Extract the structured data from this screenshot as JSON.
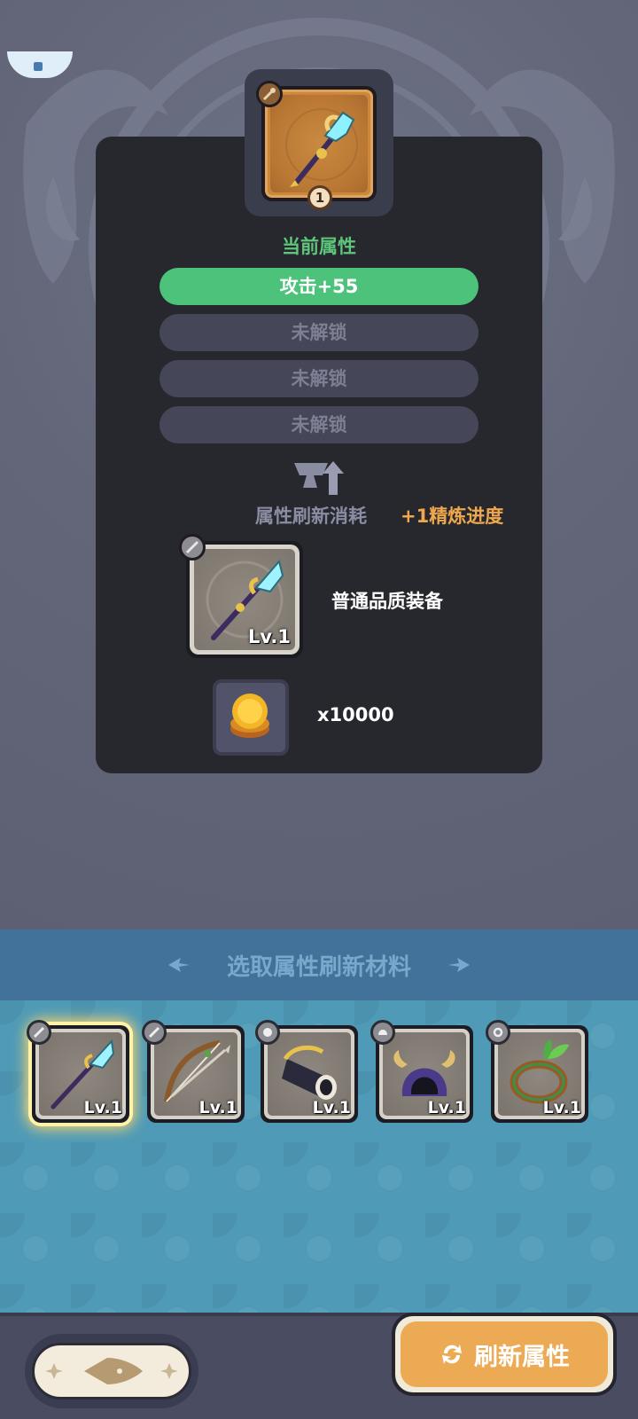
{
  "top_equipment": {
    "icon": "crystal-staff-icon",
    "type_icon": "staff-type-icon",
    "count": "1"
  },
  "attributes": {
    "title": "当前属性",
    "rows": [
      {
        "label": "攻击+55",
        "state": "active"
      },
      {
        "label": "未解锁",
        "state": "locked"
      },
      {
        "label": "未解锁",
        "state": "locked"
      },
      {
        "label": "未解锁",
        "state": "locked"
      }
    ]
  },
  "cost": {
    "label": "属性刷新消耗",
    "refine_progress": "+1精炼进度",
    "material": {
      "icon": "crystal-spear-icon",
      "level": "Lv.1",
      "label": "普通品质装备"
    },
    "coins": {
      "icon": "gold-coin-stack-icon",
      "amount": "x10000"
    }
  },
  "picker": {
    "title": "选取属性刷新材料",
    "items": [
      {
        "icon": "crystal-spear-icon",
        "badge_icon": "sword-type-icon",
        "level": "Lv.1",
        "selected": true
      },
      {
        "icon": "bow-icon",
        "badge_icon": "sword-type-icon",
        "level": "Lv.1",
        "selected": false
      },
      {
        "icon": "bracer-icon",
        "badge_icon": "glove-type-icon",
        "level": "Lv.1",
        "selected": false
      },
      {
        "icon": "horned-hood-icon",
        "badge_icon": "helmet-type-icon",
        "level": "Lv.1",
        "selected": false
      },
      {
        "icon": "leaf-ring-icon",
        "badge_icon": "ring-type-icon",
        "level": "Lv.1",
        "selected": false
      }
    ]
  },
  "actions": {
    "refresh_label": "刷新属性",
    "refresh_icon": "refresh-icon",
    "back_icon": "back-arrow-icon"
  },
  "colors": {
    "active_attr": "#4cc27a",
    "refine_text": "#efa84e",
    "refresh_button": "#ecaa55"
  }
}
